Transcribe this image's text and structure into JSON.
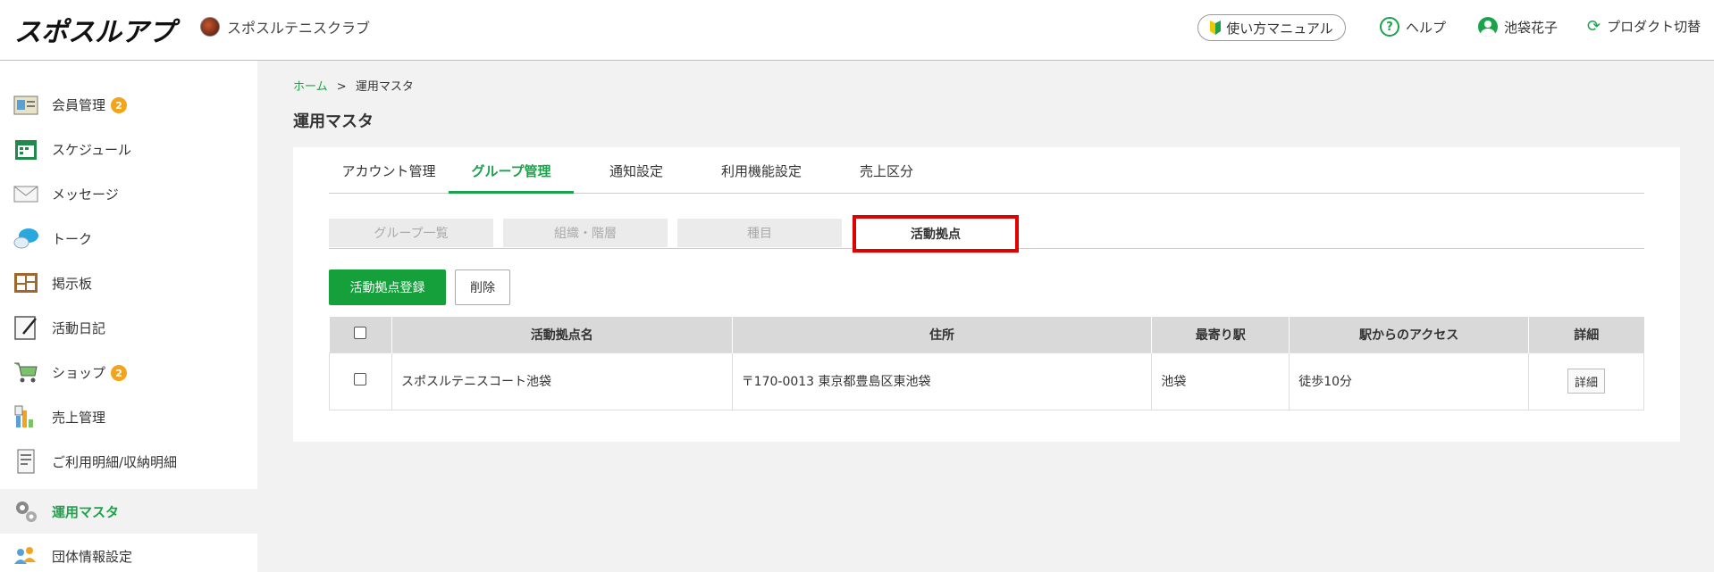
{
  "header": {
    "logo_text": "スポスルアプリ",
    "club_name": "スポスルテニスクラブ",
    "manual_label": "使い方マニュアル",
    "help_label": "ヘルプ",
    "user_name": "池袋花子",
    "switch_label": "プロダクト切替"
  },
  "sidebar": {
    "items": [
      {
        "label": "会員管理",
        "badge": "2",
        "icon": "member-card-icon"
      },
      {
        "label": "スケジュール",
        "icon": "calendar-icon"
      },
      {
        "label": "メッセージ",
        "icon": "envelope-icon"
      },
      {
        "label": "トーク",
        "icon": "chat-bubble-icon"
      },
      {
        "label": "掲示板",
        "icon": "bulletin-board-icon"
      },
      {
        "label": "活動日記",
        "icon": "diary-icon"
      },
      {
        "label": "ショップ",
        "badge": "2",
        "icon": "shopping-cart-icon"
      },
      {
        "label": "売上管理",
        "icon": "sales-chart-icon"
      },
      {
        "label": "ご利用明細/収納明細",
        "icon": "receipt-icon"
      },
      {
        "label": "運用マスタ",
        "icon": "gears-icon",
        "active": true
      },
      {
        "label": "団体情報設定",
        "icon": "group-settings-icon"
      }
    ]
  },
  "breadcrumb": {
    "home": "ホーム",
    "separator": ">",
    "current": "運用マスタ"
  },
  "page_title": "運用マスタ",
  "tabs": [
    "アカウント管理",
    "グループ管理",
    "通知設定",
    "利用機能設定",
    "売上区分"
  ],
  "active_tab": "グループ管理",
  "subtabs": [
    "グループ一覧",
    "組織・階層",
    "種目",
    "活動拠点"
  ],
  "active_subtab": "活動拠点",
  "buttons": {
    "register": "活動拠点登録",
    "delete": "削除"
  },
  "table": {
    "headers": [
      "活動拠点名",
      "住所",
      "最寄り駅",
      "駅からのアクセス",
      "詳細"
    ],
    "rows": [
      {
        "name": "スポスルテニスコート池袋",
        "address": "〒170-0013 東京都豊島区東池袋",
        "station": "池袋",
        "access": "徒歩10分",
        "detail": "詳細"
      }
    ]
  },
  "colors": {
    "brand_green": "#1aa34a",
    "button_green": "#15a03c",
    "highlight_red": "#e00000",
    "badge_orange": "#f2a51c"
  }
}
